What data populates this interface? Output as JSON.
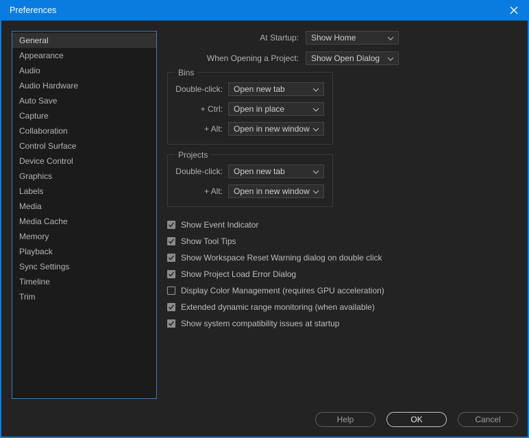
{
  "window": {
    "title": "Preferences",
    "close_icon": "close-icon",
    "accent_color": "#0a7ce0",
    "body_color": "#232323"
  },
  "sidebar": {
    "selected": "General",
    "items": [
      {
        "label": "General"
      },
      {
        "label": "Appearance"
      },
      {
        "label": "Audio"
      },
      {
        "label": "Audio Hardware"
      },
      {
        "label": "Auto Save"
      },
      {
        "label": "Capture"
      },
      {
        "label": "Collaboration"
      },
      {
        "label": "Control Surface"
      },
      {
        "label": "Device Control"
      },
      {
        "label": "Graphics"
      },
      {
        "label": "Labels"
      },
      {
        "label": "Media"
      },
      {
        "label": "Media Cache"
      },
      {
        "label": "Memory"
      },
      {
        "label": "Playback"
      },
      {
        "label": "Sync Settings"
      },
      {
        "label": "Timeline"
      },
      {
        "label": "Trim"
      }
    ]
  },
  "general": {
    "startup": {
      "label": "At Startup:",
      "value": "Show Home"
    },
    "opening_project": {
      "label": "When Opening a Project:",
      "value": "Show Open Dialog"
    },
    "bins": {
      "title": "Bins",
      "rows": [
        {
          "label": "Double-click:",
          "value": "Open new tab"
        },
        {
          "label": "+ Ctrl:",
          "value": "Open in place"
        },
        {
          "label": "+ Alt:",
          "value": "Open in new window"
        }
      ]
    },
    "projects": {
      "title": "Projects",
      "rows": [
        {
          "label": "Double-click:",
          "value": "Open new tab"
        },
        {
          "label": "+ Alt:",
          "value": "Open in new window"
        }
      ]
    },
    "checkboxes": [
      {
        "label": "Show Event Indicator",
        "checked": true
      },
      {
        "label": "Show Tool Tips",
        "checked": true
      },
      {
        "label": "Show Workspace Reset Warning dialog on double click",
        "checked": true
      },
      {
        "label": "Show Project Load Error Dialog",
        "checked": true
      },
      {
        "label": "Display Color Management (requires GPU acceleration)",
        "checked": false
      },
      {
        "label": "Extended dynamic range monitoring (when available)",
        "checked": true
      },
      {
        "label": "Show system compatibility issues at startup",
        "checked": true
      }
    ]
  },
  "footer": {
    "help_label": "Help",
    "ok_label": "OK",
    "cancel_label": "Cancel"
  }
}
